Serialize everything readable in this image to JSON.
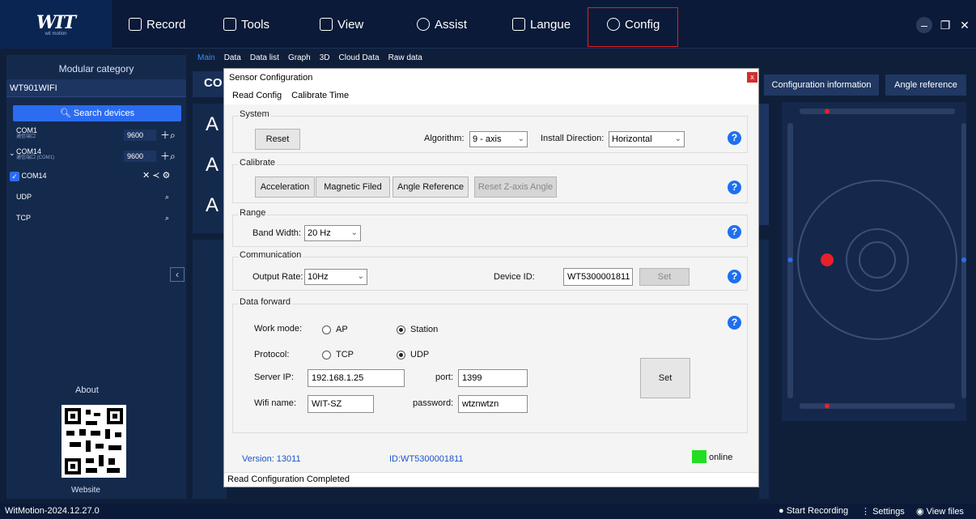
{
  "app": {
    "logo_text": "WIT",
    "logo_sub": "wit motion",
    "menu": [
      {
        "label": "Record",
        "icon": "record-icon"
      },
      {
        "label": "Tools",
        "icon": "tools-icon"
      },
      {
        "label": "View",
        "icon": "view-icon"
      },
      {
        "label": "Assist",
        "icon": "assist-icon"
      },
      {
        "label": "Langue",
        "icon": "language-icon"
      },
      {
        "label": "Config",
        "icon": "gear-icon"
      }
    ],
    "version": "WitMotion-2024.12.27.0"
  },
  "sidebar": {
    "title": "Modular category",
    "selected_module": "WT901WIFI",
    "search_label": "Search devices",
    "ports": [
      {
        "name": "COM1",
        "sub": "通信端口",
        "baud": "9600"
      },
      {
        "name": "COM14",
        "sub": "通信端口 (COM1)",
        "baud": "9600"
      },
      {
        "name": "COM14",
        "sub": "",
        "baud": ""
      },
      {
        "name": "UDP",
        "sub": "",
        "baud": ""
      },
      {
        "name": "TCP",
        "sub": "",
        "baud": ""
      }
    ],
    "about": "About",
    "website": "Website"
  },
  "main": {
    "tabs": [
      "Main",
      "Data",
      "Data list",
      "Graph",
      "3D",
      "Cloud Data",
      "Raw data"
    ],
    "heading_partial": "CO",
    "big_letters": [
      "A",
      "A",
      "A"
    ],
    "right_buttons": [
      "Configuration information",
      "Angle reference"
    ]
  },
  "dialog": {
    "title": "Sensor Configuration",
    "close": "x",
    "menu": [
      "Read Config",
      "Calibrate Time"
    ],
    "system": {
      "title": "System",
      "reset": "Reset",
      "algorithm_label": "Algorithm:",
      "algorithm_value": "9 - axis",
      "install_label": "Install Direction:",
      "install_value": "Horizontal"
    },
    "calibrate": {
      "title": "Calibrate",
      "buttons": [
        "Acceleration",
        "Magnetic Filed",
        "Angle Reference",
        "Reset Z-axis Angle"
      ]
    },
    "range": {
      "title": "Range",
      "bandwidth_label": "Band Width:",
      "bandwidth_value": "20  Hz"
    },
    "communication": {
      "title": "Communication",
      "rate_label": "Output Rate:",
      "rate_value": "10Hz",
      "device_label": "Device ID:",
      "device_value": "WT5300001811",
      "set": "Set"
    },
    "forward": {
      "title": "Data forward",
      "work_label": "Work mode:",
      "work_ap": "AP",
      "work_station": "Station",
      "protocol_label": "Protocol:",
      "protocol_tcp": "TCP",
      "protocol_udp": "UDP",
      "server_label": "Server IP:",
      "server_value": "192.168.1.25",
      "port_label": "port:",
      "port_value": "1399",
      "wifi_label": "Wifi name:",
      "wifi_value": "WIT-SZ",
      "password_label": "password:",
      "password_value": "wtznwtzn",
      "set": "Set"
    },
    "version": "Version:  13011",
    "id": "ID:WT5300001811",
    "online": "online",
    "status": "Read Configuration Completed",
    "help": "?"
  },
  "footer": {
    "start_recording": "Start Recording",
    "settings": "Settings",
    "view_files": "View files"
  },
  "colors": {
    "accent": "#2b6cf0",
    "help_blue": "#1e6ff0",
    "online_green": "#22dd22",
    "config_highlight": "#e02020",
    "indicator_red": "#e8202a"
  }
}
